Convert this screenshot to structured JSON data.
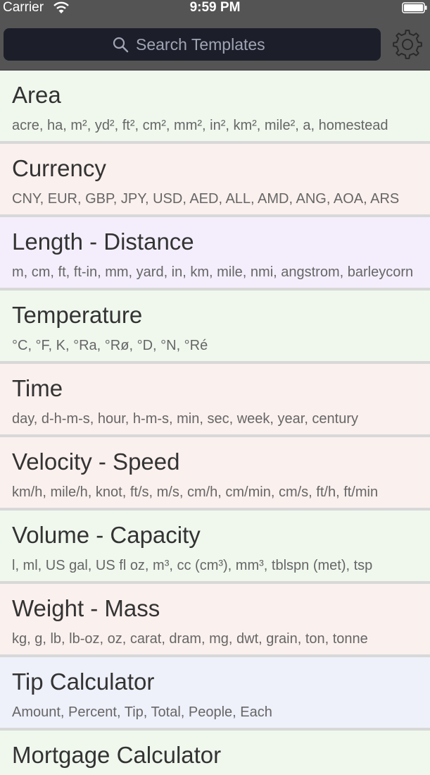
{
  "status_bar": {
    "carrier": "Carrier",
    "time": "9:59 PM"
  },
  "nav": {
    "search_placeholder": "Search Templates",
    "settings_icon": "gear-icon"
  },
  "templates": [
    {
      "title": "Area",
      "units": "acre, ha, m², yd², ft², cm², mm², in², km², mile², a, homestead",
      "bg": "#f0f8ee"
    },
    {
      "title": "Currency",
      "units": "CNY, EUR, GBP, JPY, USD, AED, ALL, AMD, ANG, AOA, ARS",
      "bg": "#faf0ee"
    },
    {
      "title": "Length - Distance",
      "units": "m, cm, ft, ft-in, mm, yard, in, km, mile, nmi, angstrom, barleycorn",
      "bg": "#f4eefc"
    },
    {
      "title": "Temperature",
      "units": "°C, °F, K, °Ra, °Rø, °D, °N, °Ré",
      "bg": "#f0f8ee"
    },
    {
      "title": "Time",
      "units": "day, d-h-m-s, hour, h-m-s, min, sec, week, year, century",
      "bg": "#faf0ee"
    },
    {
      "title": "Velocity - Speed",
      "units": "km/h, mile/h, knot, ft/s, m/s, cm/h, cm/min, cm/s, ft/h, ft/min",
      "bg": "#faf0ee"
    },
    {
      "title": "Volume - Capacity",
      "units": "l, ml, US gal, US fl oz, m³, cc (cm³), mm³, tblspn (met), tsp",
      "bg": "#f0f8ee"
    },
    {
      "title": "Weight - Mass",
      "units": "kg, g, lb, lb-oz, oz, carat, dram, mg, dwt, grain, ton, tonne",
      "bg": "#faf0ee"
    },
    {
      "title": "Tip Calculator",
      "units": "Amount, Percent, Tip, Total, People, Each",
      "bg": "#eef0fa"
    },
    {
      "title": "Mortgage Calculator",
      "units": "",
      "bg": "#f0f8ee"
    }
  ]
}
